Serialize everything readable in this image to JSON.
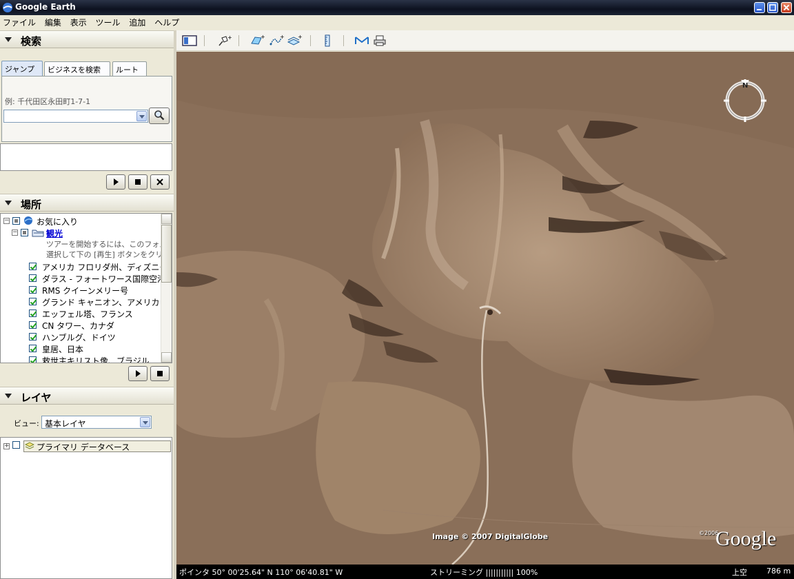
{
  "window": {
    "title": "Google Earth"
  },
  "menu": [
    "ファイル",
    "編集",
    "表示",
    "ツール",
    "追加",
    "ヘルプ"
  ],
  "search": {
    "header": "検索",
    "tabs": [
      "ジャンプ",
      "ビジネスを検索",
      "ルート"
    ],
    "hint": "例: 千代田区永田町1-7-1",
    "input_value": ""
  },
  "places": {
    "header": "場所",
    "favorites_label": "お気に入り",
    "tour_folder_label": "観光",
    "tour_description": [
      "ツアーを開始するには、このフォル",
      "選択して下の [再生] ボタンをクリ"
    ],
    "items": [
      "アメリカ フロリダ州、ディズニーランド",
      "ダラス - フォートワース国際空港",
      "RMS クイーンメリー号",
      "グランド キャニオン、アメリカ",
      "エッフェル塔、フランス",
      "CN タワー、カナダ",
      "ハンブルグ、ドイツ",
      "皇居、日本",
      "救世主キリスト像、ブラジル"
    ]
  },
  "layers": {
    "header": "レイヤ",
    "view_label": "ビュー:",
    "view_value": "基本レイヤ",
    "primary_db": "プライマリ データベース"
  },
  "map": {
    "attribution": "Image © 2007 DigitalGlobe",
    "logo_year": "©2006",
    "logo_text": "Google",
    "compass_letter": "N"
  },
  "status": {
    "pointer": "ポインタ 50° 00'25.64\" N  110° 06'40.81\" W",
    "streaming": "ストリーミング |||||||||||  100%",
    "altitude_label": "上空",
    "altitude_value": "786 m"
  },
  "colors": {
    "title_bar": "#0d1220",
    "terrain": "#8d725b",
    "accent": "#316ac5"
  }
}
